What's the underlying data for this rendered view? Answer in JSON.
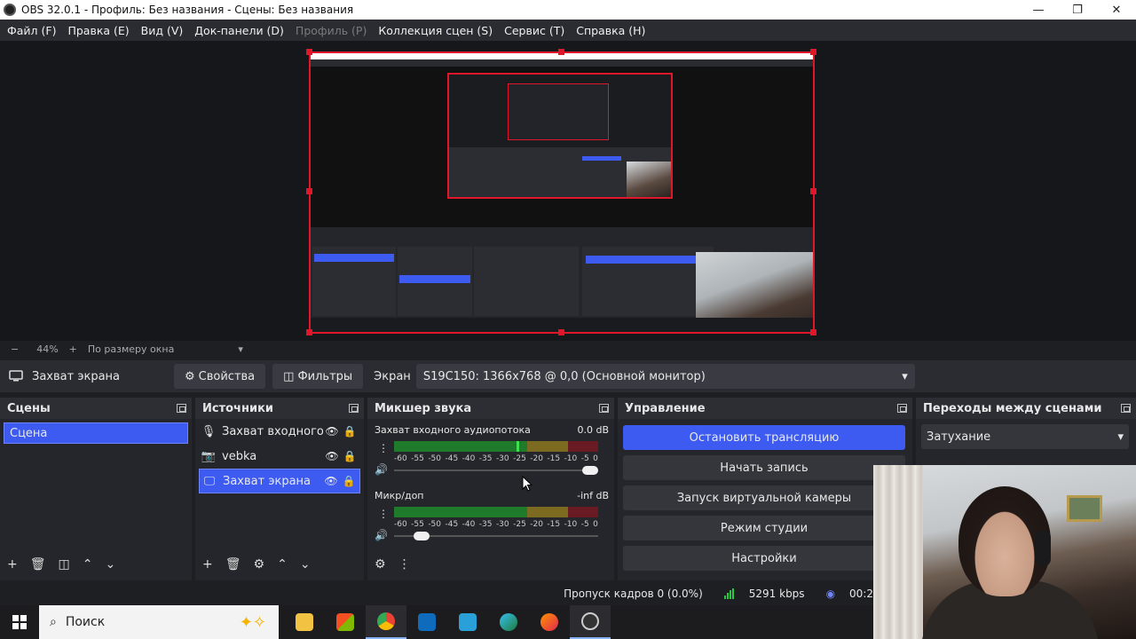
{
  "window": {
    "title": "OBS 32.0.1 - Профиль: Без названия - Сцены: Без названия",
    "controls": [
      "—",
      "❐",
      "✕"
    ]
  },
  "menu": [
    {
      "label": "Файл (F)",
      "enabled": true
    },
    {
      "label": "Правка (E)",
      "enabled": true
    },
    {
      "label": "Вид (V)",
      "enabled": true
    },
    {
      "label": "Док-панели (D)",
      "enabled": true
    },
    {
      "label": "Профиль (P)",
      "enabled": false
    },
    {
      "label": "Коллекция сцен (S)",
      "enabled": true
    },
    {
      "label": "Сервис (T)",
      "enabled": true
    },
    {
      "label": "Справка (H)",
      "enabled": true
    }
  ],
  "zoom": {
    "minus": "−",
    "value": "44%",
    "plus": "+",
    "mode": "По размеру окна"
  },
  "source_toolbar": {
    "current_source": "Захват экрана",
    "properties": "Свойства",
    "filters": "Фильтры",
    "display_label": "Экран",
    "display_value": "S19C150: 1366x768 @ 0,0 (Основной монитор)"
  },
  "scenes": {
    "title": "Сцены",
    "items": [
      "Сцена"
    ]
  },
  "sources": {
    "title": "Источники",
    "items": [
      {
        "name": "Захват входного аудиопотока",
        "icon": "microphone-icon",
        "selected": false
      },
      {
        "name": "vebka",
        "icon": "camera-icon",
        "selected": false
      },
      {
        "name": "Захват экрана",
        "icon": "monitor-icon",
        "selected": true
      }
    ]
  },
  "mixer": {
    "title": "Микшер звука",
    "channels": [
      {
        "name": "Захват входного аудиопотока",
        "db": "0.0 dB",
        "level": 0.6,
        "volume": 1.0
      },
      {
        "name": "Микр/доп",
        "db": "-inf dB",
        "level": 0.0,
        "volume": 0.0
      }
    ],
    "ticks": [
      "-60",
      "-55",
      "-50",
      "-45",
      "-40",
      "-35",
      "-30",
      "-25",
      "-20",
      "-15",
      "-10",
      "-5",
      "0"
    ]
  },
  "controls": {
    "title": "Управление",
    "buttons": [
      "Остановить трансляцию",
      "Начать запись",
      "Запуск виртуальной камеры",
      "Режим студии",
      "Настройки"
    ]
  },
  "transitions": {
    "title": "Переходы между сценами",
    "selected": "Затухание"
  },
  "status": {
    "dropped": "Пропуск кадров 0 (0.0%)",
    "bitrate": "5291 kbps",
    "time": "00:2"
  },
  "taskbar": {
    "search_placeholder": "Поиск",
    "apps": [
      "file-explorer-icon",
      "store-icon",
      "chrome-icon",
      "outlook-icon",
      "news-icon",
      "edge-icon",
      "firefox-icon",
      "obs-icon"
    ]
  },
  "colors": {
    "accent": "#3d5af1",
    "selection_border": "#e0162b",
    "meter_green": "#1f7a2b",
    "meter_yellow": "#7c6a20",
    "meter_red": "#6a1a22"
  }
}
